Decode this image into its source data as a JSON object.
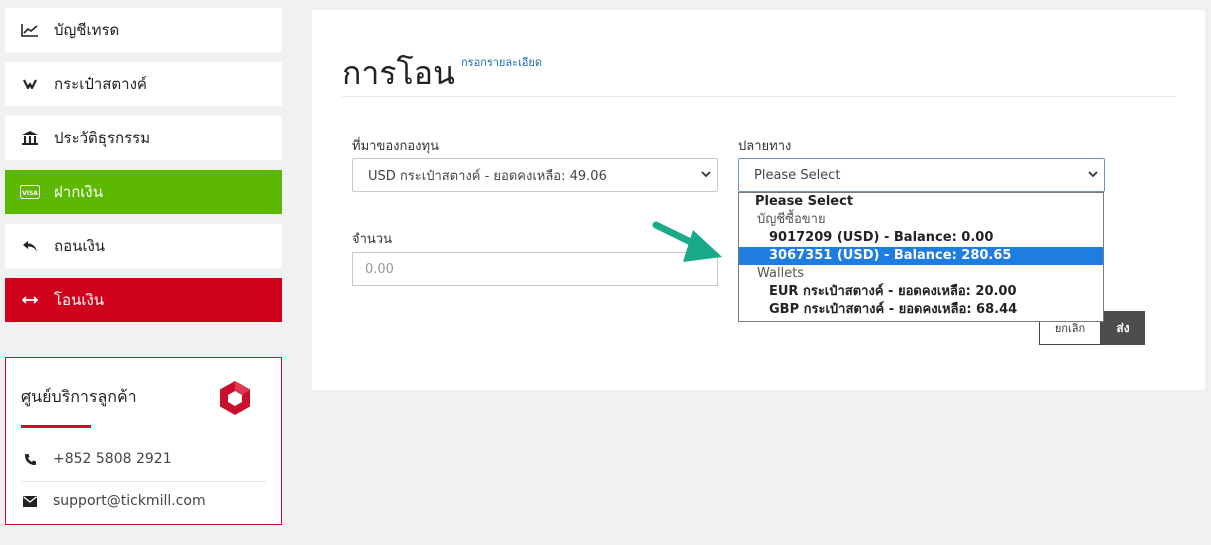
{
  "sidebar": {
    "items": [
      {
        "label": "บัญชีเทรด",
        "icon": "chart-line-icon"
      },
      {
        "label": "กระเป๋าสตางค์",
        "icon": "wallet-icon"
      },
      {
        "label": "ประวัติธุรกรรม",
        "icon": "bank-icon"
      },
      {
        "label": "ฝากเงิน",
        "icon": "visa-card-icon"
      },
      {
        "label": "ถอนเงิน",
        "icon": "reply-arrow-icon"
      },
      {
        "label": "โอนเงิน",
        "icon": "transfer-arrows-icon"
      }
    ]
  },
  "support": {
    "title": "ศูนย์บริการลูกค้า",
    "phone": "+852 5808 2921",
    "email": "support@tickmill.com"
  },
  "main": {
    "title": "การโอน",
    "detail_link": "กรอกรายละเอียด",
    "source_label": "ที่มาของกองทุน",
    "source_value": "USD กระเป๋าสตางค์ - ยอดคงเหลือ: 49.06",
    "destination_label": "ปลายทาง",
    "destination_value": "Please Select",
    "amount_label": "จำนวน",
    "amount_placeholder": "0.00",
    "cancel_label": "ยกเลิก",
    "send_label": "ส่ง"
  },
  "dropdown": {
    "options": [
      {
        "label": "Please Select",
        "type": "option"
      },
      {
        "label": "บัญชีซื้อขาย",
        "type": "group"
      },
      {
        "label": "9017209 (USD) - Balance: 0.00",
        "type": "option"
      },
      {
        "label": "3067351 (USD) - Balance: 280.65",
        "type": "option",
        "selected": true
      },
      {
        "label": "Wallets",
        "type": "group"
      },
      {
        "label": "EUR กระเป๋าสตางค์ - ยอดคงเหลือ: 20.00",
        "type": "option"
      },
      {
        "label": "GBP กระเป๋าสตางค์ - ยอดคงเหลือ: 68.44",
        "type": "option"
      }
    ]
  },
  "colors": {
    "green": "#5cb800",
    "red": "#d0021b",
    "brand": "#c8102e",
    "link": "#1a6aa8",
    "selection": "#1e7de0",
    "arrow": "#1aaa8a"
  }
}
